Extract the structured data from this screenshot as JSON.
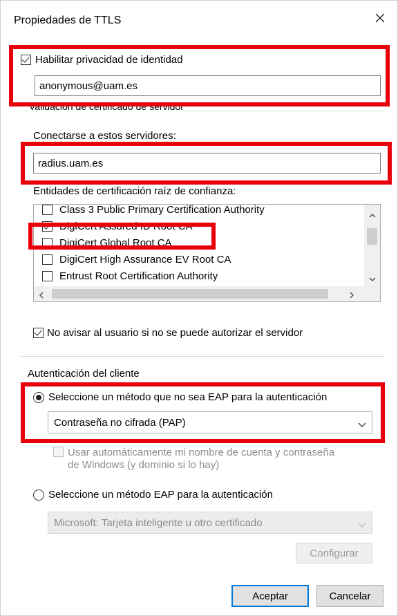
{
  "window": {
    "title": "Propiedades de TTLS"
  },
  "identity_privacy": {
    "label": "Habilitar privacidad de identidad",
    "checked": true,
    "value": "anonymous@uam.es"
  },
  "server_validation": {
    "group_label": "Validación de certificado de servidor",
    "connect_label": "Conectarse a estos servidores:",
    "servers_value": "radius.uam.es",
    "roots_label": "Entidades de certificación raíz de confianza:",
    "roots": [
      {
        "label": "Class 3 Public Primary Certification Authority",
        "checked": false
      },
      {
        "label": "DigiCert Assured ID Root CA",
        "checked": true
      },
      {
        "label": "DigiCert Global Root CA",
        "checked": false
      },
      {
        "label": "DigiCert High Assurance EV Root CA",
        "checked": false
      },
      {
        "label": "Entrust Root Certification Authority",
        "checked": false
      }
    ],
    "no_prompt_label": "No avisar al usuario si no se puede autorizar el servidor",
    "no_prompt_checked": true
  },
  "client_auth": {
    "group_label": "Autenticación del cliente",
    "non_eap_label": "Seleccione un método que no sea EAP para la autenticación",
    "non_eap_selected": true,
    "non_eap_method": "Contraseña no cifrada (PAP)",
    "auto_creds_line1": "Usar automáticamente mi nombre de cuenta y contraseña",
    "auto_creds_line2": "de Windows (y dominio si lo hay)",
    "eap_label": "Seleccione un método EAP para la autenticación",
    "eap_method": "Microsoft: Tarjeta inteligente u otro certificado",
    "configure_label": "Configurar"
  },
  "buttons": {
    "ok": "Aceptar",
    "cancel": "Cancelar"
  },
  "colors": {
    "highlight_red": "#e8000b",
    "default_button_blue": "#0078d7"
  }
}
